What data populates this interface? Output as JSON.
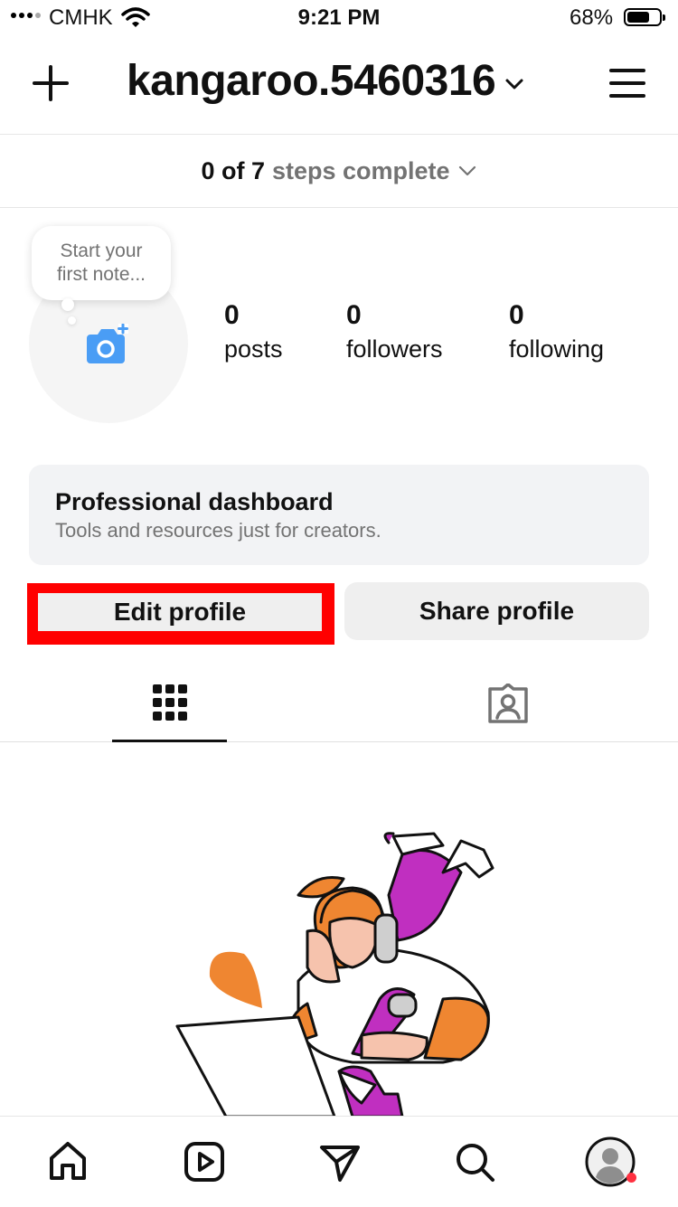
{
  "status_bar": {
    "carrier": "CMHK",
    "time": "9:21 PM",
    "battery": "68%"
  },
  "header": {
    "username": "kangaroo.5460316"
  },
  "steps": {
    "count": "0 of 7",
    "label": "steps complete"
  },
  "profile": {
    "note_line1": "Start your",
    "note_line2": "first note...",
    "stats": [
      {
        "value": "0",
        "label": "posts"
      },
      {
        "value": "0",
        "label": "followers"
      },
      {
        "value": "0",
        "label": "following"
      }
    ]
  },
  "dashboard": {
    "title": "Professional dashboard",
    "subtitle": "Tools and resources just for creators."
  },
  "buttons": {
    "edit_label": "Edit profile",
    "share_label": "Share profile"
  },
  "colors": {
    "accent_blue": "#4a9df5",
    "highlight_red": "#ff0000",
    "notification_dot": "#ff3040",
    "illustration_purple": "#c02fc0",
    "illustration_orange": "#ef8631"
  },
  "icons": {
    "header": [
      "plus-icon",
      "chevron-down-icon",
      "menu-icon"
    ],
    "tabs": [
      "grid-icon",
      "tagged-icon"
    ],
    "nav": [
      "home-icon",
      "reels-icon",
      "send-icon",
      "search-icon",
      "profile-icon"
    ]
  }
}
